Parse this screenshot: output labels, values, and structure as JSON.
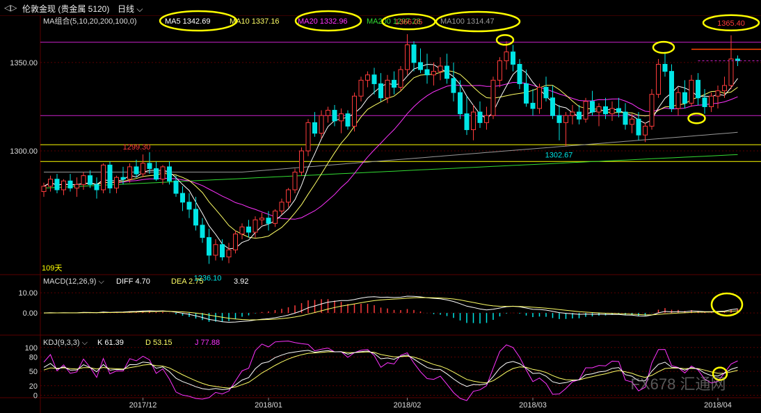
{
  "toolbar": {
    "instrument": "伦敦金现 (贵金属 5120)",
    "period": "日线"
  },
  "colors": {
    "up": "#ff3b3b",
    "down": "#00e5e5",
    "ma5": "#ffffff",
    "ma10": "#ffff66",
    "ma20": "#ff33ff",
    "ma200": "#33dd33",
    "ma100": "#999999",
    "grid": "#5a0000",
    "highlight": "#ffff00"
  },
  "chart_data": [
    {
      "type": "candlestick",
      "title": "MA组合(5,10,20,200,100,0)",
      "legend": [
        {
          "label": "MA5",
          "value": "1342.69"
        },
        {
          "label": "MA10",
          "value": "1337.16"
        },
        {
          "label": "MA20",
          "value": "1332.96"
        },
        {
          "label": "MA200",
          "value": "1297.28"
        },
        {
          "label": "MA100",
          "value": "1314.47"
        }
      ],
      "y_ticks": [
        "1350.00",
        "1300.00"
      ],
      "ylim": [
        1230,
        1372
      ],
      "x_ticks": [
        "2017/12",
        "2018/01",
        "2018/02",
        "2018/03",
        "2018/04"
      ],
      "annotations": [
        "1366.05",
        "1365.40",
        "1299.30",
        "1302.67",
        "1236.10",
        "109天"
      ],
      "horizontal_lines": [
        1361.5,
        1320.0,
        1303.5,
        1294.0
      ],
      "ohlc": [
        [
          1277,
          1282,
          1274,
          1280
        ],
        [
          1280,
          1286,
          1277,
          1284
        ],
        [
          1284,
          1287,
          1276,
          1278
        ],
        [
          1278,
          1284,
          1275,
          1283
        ],
        [
          1283,
          1287,
          1277,
          1279
        ],
        [
          1279,
          1285,
          1274,
          1281
        ],
        [
          1281,
          1288,
          1278,
          1286
        ],
        [
          1286,
          1289,
          1279,
          1281
        ],
        [
          1281,
          1285,
          1273,
          1278
        ],
        [
          1278,
          1293,
          1276,
          1292
        ],
        [
          1292,
          1294,
          1276,
          1279
        ],
        [
          1279,
          1286,
          1276,
          1285
        ],
        [
          1285,
          1291,
          1281,
          1284
        ],
        [
          1284,
          1293,
          1282,
          1291
        ],
        [
          1291,
          1295,
          1285,
          1287
        ],
        [
          1287,
          1298,
          1285,
          1293
        ],
        [
          1293,
          1299.3,
          1287,
          1290
        ],
        [
          1290,
          1294,
          1283,
          1284
        ],
        [
          1284,
          1292,
          1281,
          1291
        ],
        [
          1291,
          1294,
          1281,
          1283
        ],
        [
          1283,
          1286,
          1274,
          1276
        ],
        [
          1276,
          1280,
          1266,
          1271
        ],
        [
          1271,
          1276,
          1262,
          1267
        ],
        [
          1267,
          1274,
          1255,
          1258
        ],
        [
          1258,
          1262,
          1248,
          1251
        ],
        [
          1251,
          1256,
          1236.1,
          1241
        ],
        [
          1241,
          1250,
          1238,
          1247
        ],
        [
          1247,
          1250,
          1238,
          1240
        ],
        [
          1240,
          1248,
          1236.5,
          1244
        ],
        [
          1244,
          1255,
          1242,
          1253
        ],
        [
          1253,
          1259,
          1250,
          1257
        ],
        [
          1257,
          1261,
          1251,
          1254
        ],
        [
          1254,
          1263,
          1251,
          1261
        ],
        [
          1261,
          1265,
          1258,
          1262
        ],
        [
          1262,
          1266,
          1255,
          1259
        ],
        [
          1259,
          1267,
          1257,
          1266
        ],
        [
          1266,
          1273,
          1264,
          1271
        ],
        [
          1271,
          1279,
          1268,
          1278
        ],
        [
          1278,
          1290,
          1276,
          1288
        ],
        [
          1288,
          1302,
          1286,
          1300
        ],
        [
          1300,
          1318,
          1297,
          1316
        ],
        [
          1316,
          1322,
          1308,
          1310
        ],
        [
          1310,
          1323,
          1307,
          1320
        ],
        [
          1320,
          1325,
          1316,
          1323
        ],
        [
          1323,
          1326,
          1314,
          1317
        ],
        [
          1317,
          1324,
          1310,
          1321
        ],
        [
          1321,
          1323,
          1312,
          1314
        ],
        [
          1314,
          1333,
          1311,
          1331
        ],
        [
          1331,
          1342,
          1328,
          1340
        ],
        [
          1340,
          1345,
          1336,
          1343
        ],
        [
          1343,
          1347,
          1332,
          1338
        ],
        [
          1338,
          1344,
          1328,
          1330
        ],
        [
          1330,
          1343,
          1327,
          1340
        ],
        [
          1340,
          1345,
          1332,
          1336
        ],
        [
          1336,
          1348,
          1334,
          1346
        ],
        [
          1346,
          1366.05,
          1343,
          1360
        ],
        [
          1360,
          1362,
          1345,
          1350
        ],
        [
          1350,
          1358,
          1344,
          1346
        ],
        [
          1346,
          1355,
          1338,
          1343
        ],
        [
          1343,
          1350,
          1337,
          1345
        ],
        [
          1345,
          1353,
          1340,
          1348
        ],
        [
          1348,
          1355,
          1338,
          1341
        ],
        [
          1341,
          1350,
          1328,
          1333
        ],
        [
          1333,
          1340,
          1318,
          1321
        ],
        [
          1321,
          1331,
          1309,
          1312
        ],
        [
          1312,
          1326,
          1306,
          1322
        ],
        [
          1322,
          1328,
          1313,
          1316
        ],
        [
          1316,
          1325,
          1312,
          1320
        ],
        [
          1320,
          1342,
          1318,
          1340
        ],
        [
          1340,
          1353,
          1336,
          1351
        ],
        [
          1351,
          1362,
          1346,
          1356
        ],
        [
          1356,
          1360,
          1345,
          1349
        ],
        [
          1349,
          1352,
          1335,
          1338
        ],
        [
          1338,
          1346,
          1325,
          1327
        ],
        [
          1327,
          1335,
          1320,
          1324
        ],
        [
          1324,
          1338,
          1321,
          1336
        ],
        [
          1336,
          1342,
          1328,
          1330
        ],
        [
          1330,
          1337,
          1318,
          1320
        ],
        [
          1320,
          1326,
          1306,
          1316
        ],
        [
          1316,
          1322,
          1302.67,
          1320
        ],
        [
          1320,
          1326,
          1315,
          1322
        ],
        [
          1322,
          1326,
          1315,
          1318
        ],
        [
          1318,
          1330,
          1316,
          1328
        ],
        [
          1328,
          1334,
          1320,
          1322
        ],
        [
          1322,
          1327,
          1314,
          1325
        ],
        [
          1325,
          1330,
          1318,
          1321
        ],
        [
          1321,
          1328,
          1317,
          1324
        ],
        [
          1324,
          1330,
          1319,
          1322
        ],
        [
          1322,
          1327,
          1312,
          1315
        ],
        [
          1315,
          1321,
          1310,
          1318
        ],
        [
          1318,
          1322,
          1306,
          1309
        ],
        [
          1309,
          1316,
          1305,
          1314
        ],
        [
          1314,
          1335,
          1312,
          1332
        ],
        [
          1332,
          1352,
          1330,
          1349
        ],
        [
          1349,
          1356,
          1342,
          1345
        ],
        [
          1345,
          1349,
          1322,
          1324
        ],
        [
          1324,
          1336,
          1320,
          1333
        ],
        [
          1333,
          1340,
          1324,
          1327
        ],
        [
          1327,
          1343,
          1325,
          1340
        ],
        [
          1340,
          1344,
          1326,
          1330
        ],
        [
          1330,
          1335,
          1321,
          1325
        ],
        [
          1325,
          1333,
          1322,
          1331
        ],
        [
          1331,
          1337,
          1324,
          1334
        ],
        [
          1334,
          1342,
          1330,
          1337
        ],
        [
          1337,
          1365.4,
          1335,
          1352
        ],
        [
          1352,
          1354,
          1348,
          1351
        ]
      ]
    },
    {
      "type": "bar",
      "title": "MACD(12,26,9)",
      "legend": [
        {
          "label": "DIFF",
          "value": "4.70"
        },
        {
          "label": "DEA",
          "value": "2.75"
        },
        {
          "label": "",
          "value": "3.92"
        }
      ],
      "y_ticks": [
        "10.00",
        "0.00"
      ],
      "ylim": [
        -11,
        18
      ]
    },
    {
      "type": "line",
      "title": "KDJ(9,3,3)",
      "legend": [
        {
          "label": "K",
          "value": "61.39"
        },
        {
          "label": "D",
          "value": "53.15"
        },
        {
          "label": "J",
          "value": "77.88"
        }
      ],
      "y_ticks": [
        "100",
        "80",
        "50",
        "20",
        "0"
      ],
      "ylim": [
        -5,
        120
      ]
    }
  ],
  "watermark": "FX678 汇通网"
}
